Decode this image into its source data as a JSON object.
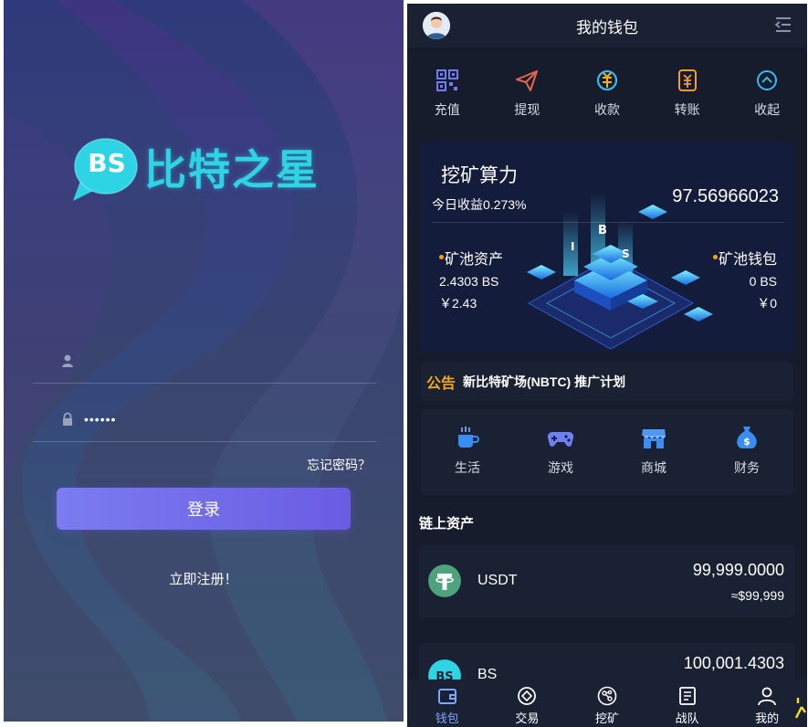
{
  "login": {
    "logo_badge": "BS",
    "logo_text": "比特之星",
    "username_value": "",
    "password_value": "••••••",
    "forgot_label": "忘记密码？",
    "login_button": "登录",
    "register_link": "立即注册！"
  },
  "wallet": {
    "header": {
      "title": "我的钱包"
    },
    "quick_actions": [
      {
        "label": "充值",
        "icon": "qrcode-icon"
      },
      {
        "label": "提现",
        "icon": "paper-plane-icon"
      },
      {
        "label": "收款",
        "icon": "receive-icon"
      },
      {
        "label": "转账",
        "icon": "transfer-icon"
      },
      {
        "label": "收起",
        "icon": "collapse-icon"
      }
    ],
    "mining": {
      "title": "挖矿算力",
      "today_rate": "今日收益0.273%",
      "total": "97.56966023",
      "pool_assets_label": "矿池资产",
      "pool_assets_bs": "2.4303 BS",
      "pool_assets_cny": "￥2.43",
      "pool_wallet_label": "矿池钱包",
      "pool_wallet_bs": "0 BS",
      "pool_wallet_cny": "￥0",
      "illustration_letters": [
        "B",
        "I",
        "S"
      ]
    },
    "notice": {
      "tag": "公告",
      "text": "新比特矿场(NBTC) 推广计划"
    },
    "services": [
      {
        "label": "生活",
        "icon": "coffee-icon"
      },
      {
        "label": "游戏",
        "icon": "gamepad-icon"
      },
      {
        "label": "商城",
        "icon": "store-icon"
      },
      {
        "label": "财务",
        "icon": "money-bag-icon"
      }
    ],
    "chain_assets_title": "链上资产",
    "assets": [
      {
        "name": "USDT",
        "amount": "99,999.0000",
        "approx": "≈$99,999",
        "icon": "tether-icon"
      },
      {
        "name": "BS",
        "amount": "100,001.4303",
        "approx": "",
        "icon": "bs-coin-icon"
      }
    ],
    "tabbar": [
      {
        "label": "钱包",
        "icon": "wallet-icon",
        "active": true
      },
      {
        "label": "交易",
        "icon": "trade-icon",
        "active": false
      },
      {
        "label": "挖矿",
        "icon": "mining-icon",
        "active": false
      },
      {
        "label": "战队",
        "icon": "team-icon",
        "active": false
      },
      {
        "label": "我的",
        "icon": "user-icon",
        "active": false
      }
    ],
    "colors": {
      "accent": "#7ea6ff",
      "gold": "#f2a720",
      "panel": "#1a2133",
      "background": "#161c2c"
    }
  }
}
